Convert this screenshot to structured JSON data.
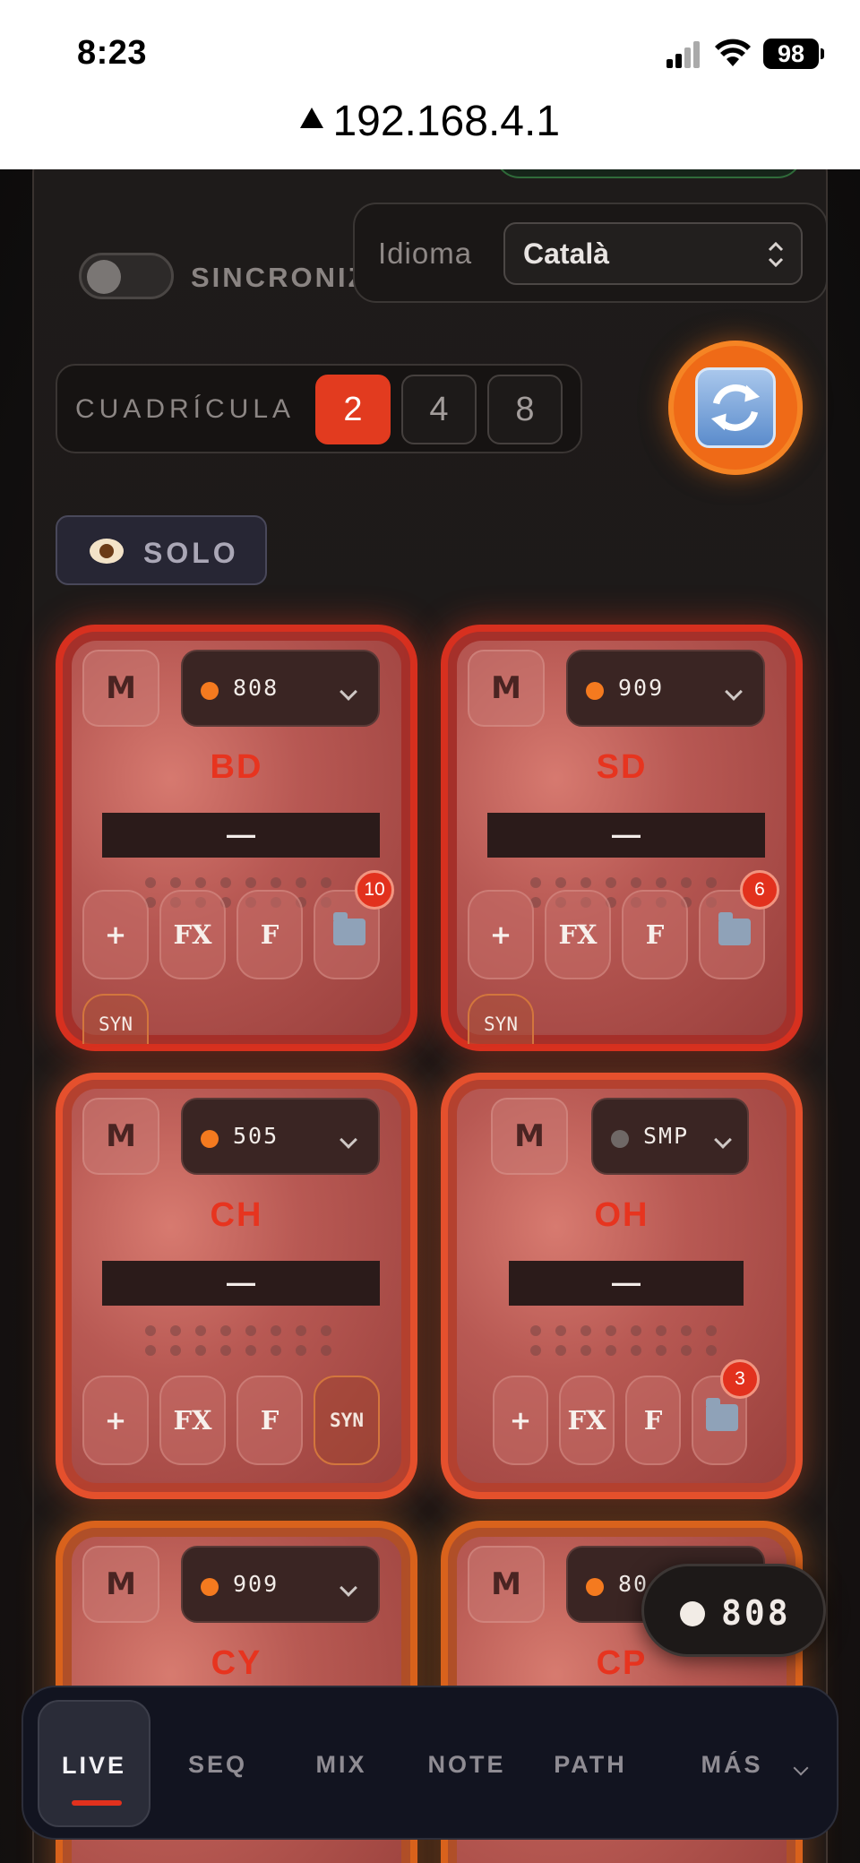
{
  "status_bar": {
    "time": "8:23",
    "battery": "98"
  },
  "url_bar": {
    "url": "192.168.4.1"
  },
  "controls": {
    "sync_label": "SINCRONIZ",
    "language_label": "Idioma",
    "language_value": "Català",
    "grid_label": "CUADRÍCULA",
    "grid_options": [
      "2",
      "4",
      "8"
    ],
    "grid_selected": "2",
    "solo_label": "SOLO"
  },
  "pads": [
    {
      "name": "BD",
      "mute": "M",
      "engine": "808",
      "meter": "—",
      "buttons": [
        "+",
        "FX",
        "F"
      ],
      "badge": "10",
      "syn": "SYN"
    },
    {
      "name": "SD",
      "mute": "M",
      "engine": "909",
      "meter": "—",
      "buttons": [
        "+",
        "FX",
        "F"
      ],
      "badge": "6",
      "syn": "SYN"
    },
    {
      "name": "CH",
      "mute": "M",
      "engine": "505",
      "meter": "—",
      "buttons": [
        "+",
        "FX",
        "F",
        "SYN"
      ]
    },
    {
      "name": "OH",
      "mute": "M",
      "engine": "SMP",
      "meter": "—",
      "buttons": [
        "+",
        "FX",
        "F"
      ],
      "badge": "3"
    },
    {
      "name": "CY",
      "mute": "M",
      "engine": "909"
    },
    {
      "name": "CP",
      "mute": "M",
      "engine": "80"
    }
  ],
  "floating_pill": {
    "label": "808"
  },
  "nav": {
    "tabs": [
      "LIVE",
      "SEQ",
      "MIX",
      "NOTE",
      "PATH",
      "MÁS"
    ],
    "active": "LIVE"
  },
  "colors": {
    "accent": "#e23b1f",
    "refresh": "#ef6a17",
    "pad_red": "#d7301f",
    "pad_orange": "#e5502d"
  }
}
